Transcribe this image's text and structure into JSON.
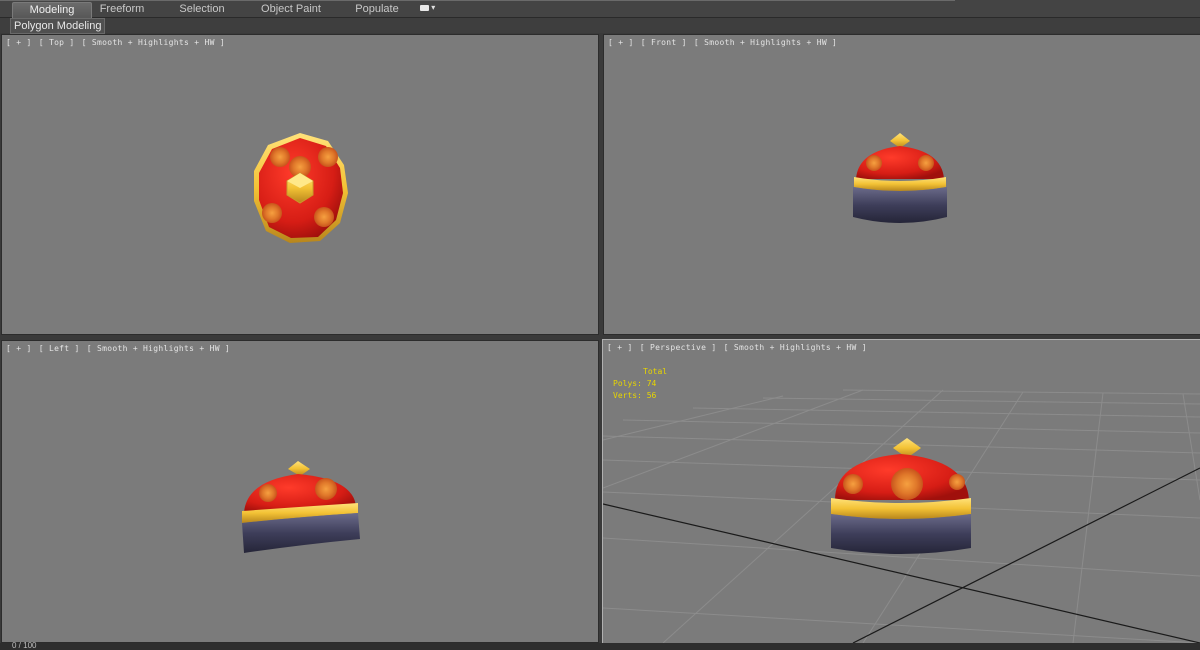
{
  "ribbon": {
    "tabs": [
      {
        "label": "Modeling",
        "active": true
      },
      {
        "label": "Freeform",
        "active": false
      },
      {
        "label": "Selection",
        "active": false
      },
      {
        "label": "Object Paint",
        "active": false
      },
      {
        "label": "Populate",
        "active": false
      }
    ],
    "extra_icon": "camera-dropdown-icon",
    "subtab": "Polygon Modeling"
  },
  "viewports": {
    "top": {
      "parts": [
        "[ + ]",
        "[ Top ]",
        "[ Smooth + Highlights + HW ]"
      ]
    },
    "front": {
      "parts": [
        "[ + ]",
        "[ Front ]",
        "[ Smooth + Highlights + HW ]"
      ]
    },
    "left": {
      "parts": [
        "[ + ]",
        "[ Left ]",
        "[ Smooth + Highlights + HW ]"
      ]
    },
    "perspective": {
      "parts": [
        "[ + ]",
        "[ Perspective ]",
        "[ Smooth + Highlights + HW ]"
      ],
      "stats": {
        "header": "Total",
        "polys": "Polys: 74",
        "verts": "Verts: 56"
      }
    }
  },
  "timeline": {
    "counter": "0 / 100"
  },
  "colors": {
    "viewport_bg": "#7b7b7b",
    "hat_red": "#d61d15",
    "hat_gold": "#f3c235",
    "hat_band": "#444466",
    "stats_yellow": "#e8d600"
  }
}
